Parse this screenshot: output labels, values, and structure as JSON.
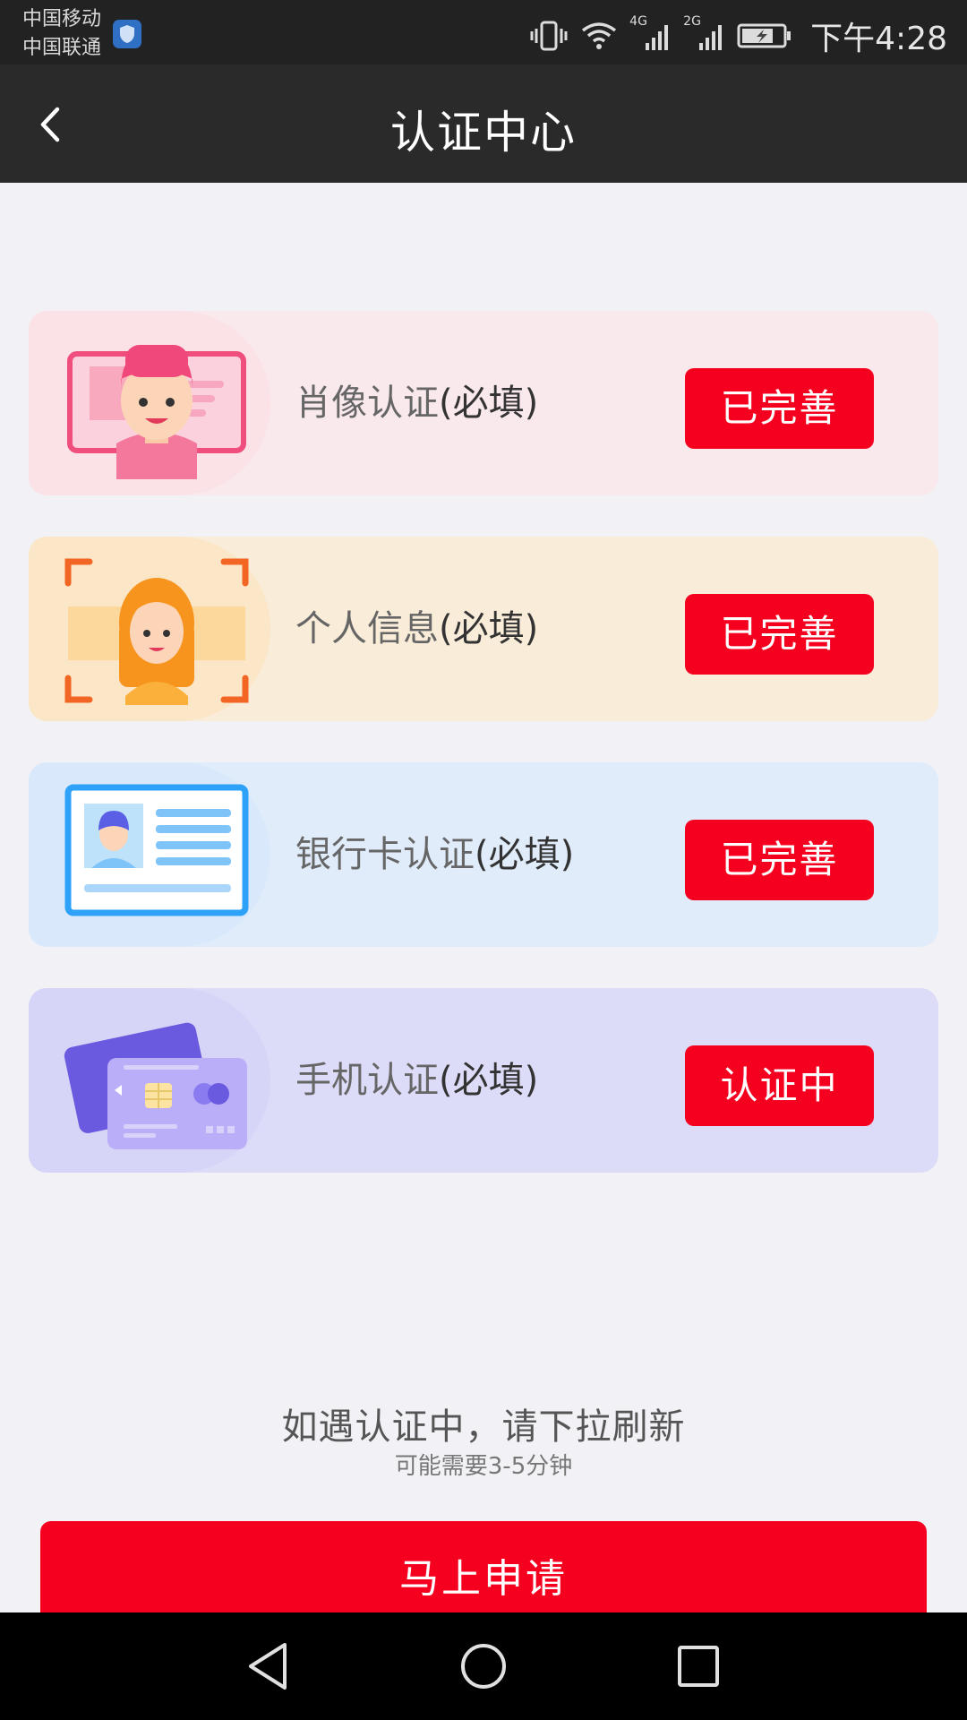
{
  "status_bar": {
    "carrier_1": "中国移动",
    "carrier_2": "中国联通",
    "network_1": "4G",
    "network_2": "2G",
    "time": "下午4:28",
    "icons": [
      "shield-icon",
      "vibrate-icon",
      "wifi-icon",
      "signal-icon",
      "battery-icon"
    ]
  },
  "nav": {
    "title": "认证中心",
    "back_icon": "chevron-left-icon"
  },
  "cards": [
    {
      "label": "肖像认证",
      "required": "(必填)",
      "status": "已完善",
      "icon": "portrait-icon"
    },
    {
      "label": "个人信息",
      "required": "(必填)",
      "status": "已完善",
      "icon": "face-scan-icon"
    },
    {
      "label": "银行卡认证",
      "required": "(必填)",
      "status": "已完善",
      "icon": "id-card-icon"
    },
    {
      "label": "手机认证",
      "required": "(必填)",
      "status": "认证中",
      "icon": "credit-card-icon"
    }
  ],
  "hint": {
    "main": "如遇认证中，请下拉刷新",
    "sub": "可能需要3-5分钟"
  },
  "apply_button": {
    "label": "马上申请"
  },
  "system_nav": [
    "back-icon",
    "home-icon",
    "recents-icon"
  ],
  "colors": {
    "accent": "#f5001f",
    "bar_dark": "#2a2a2a",
    "background": "#f2f2f6"
  }
}
